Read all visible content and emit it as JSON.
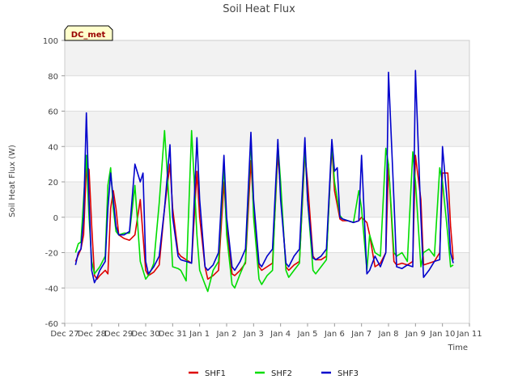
{
  "chart_data": {
    "type": "line",
    "title": "Soil Heat Flux",
    "xlabel": "Time",
    "ylabel": "Soil Heat Flux (W)",
    "ylim": [
      -60,
      100
    ],
    "yticks": [
      -60,
      -40,
      -20,
      0,
      20,
      40,
      60,
      80,
      100
    ],
    "xlim": [
      0,
      15
    ],
    "xtick_labels": [
      "Dec 27",
      "Dec 28",
      "Dec 29",
      "Dec 30",
      "Dec 31",
      "Jan 1",
      "Jan 2",
      "Jan 3",
      "Jan 4",
      "Jan 5",
      "Jan 6",
      "Jan 7",
      "Jan 8",
      "Jan 9",
      "Jan 10",
      "Jan 11"
    ],
    "grid": true,
    "legend": "bottom-center",
    "station_label": "DC_met",
    "series": [
      {
        "name": "SHF1",
        "color": "#dd0000",
        "x": [
          0.4,
          0.6,
          0.7,
          0.8,
          0.9,
          1.0,
          1.1,
          1.2,
          1.3,
          1.5,
          1.6,
          1.7,
          1.8,
          1.9,
          2.0,
          2.2,
          2.4,
          2.6,
          2.8,
          3.0,
          3.1,
          3.2,
          3.3,
          3.5,
          3.7,
          3.9,
          4.0,
          4.2,
          4.3,
          4.5,
          4.7,
          4.9,
          5.0,
          5.2,
          5.3,
          5.5,
          5.7,
          5.9,
          6.0,
          6.2,
          6.3,
          6.5,
          6.7,
          6.9,
          7.0,
          7.2,
          7.3,
          7.5,
          7.7,
          7.9,
          8.0,
          8.2,
          8.3,
          8.5,
          8.7,
          8.9,
          9.0,
          9.2,
          9.3,
          9.5,
          9.7,
          9.9,
          10.0,
          10.2,
          10.3,
          10.5,
          10.7,
          10.9,
          11.0,
          11.2,
          11.3,
          11.5,
          11.7,
          11.9,
          12.0,
          12.2,
          12.3,
          12.5,
          12.7,
          12.9,
          13.0,
          13.2,
          13.3,
          13.5,
          13.7,
          13.9,
          14.0,
          14.2,
          14.3,
          14.4
        ],
        "y": [
          -25,
          -18,
          -10,
          29,
          27,
          -5,
          -33,
          -35,
          -33,
          -30,
          -32,
          5,
          15,
          5,
          -10,
          -12,
          -13,
          -10,
          10,
          -30,
          -33,
          -32,
          -31,
          -27,
          5,
          30,
          5,
          -20,
          -22,
          -24,
          -26,
          26,
          0,
          -28,
          -35,
          -33,
          -30,
          20,
          -5,
          -32,
          -33,
          -30,
          -26,
          32,
          5,
          -28,
          -30,
          -28,
          -26,
          36,
          15,
          -28,
          -30,
          -27,
          -25,
          36,
          20,
          -22,
          -24,
          -24,
          -22,
          40,
          15,
          -1,
          -2,
          -2,
          -3,
          -2,
          0,
          -3,
          -10,
          -28,
          -26,
          -20,
          30,
          -25,
          -27,
          -26,
          -27,
          -25,
          35,
          10,
          -27,
          -26,
          -25,
          -20,
          25,
          25,
          -5,
          -24
        ]
      },
      {
        "name": "SHF2",
        "color": "#00dd00",
        "x": [
          0.4,
          0.5,
          0.6,
          0.7,
          0.8,
          0.9,
          1.0,
          1.1,
          1.2,
          1.3,
          1.5,
          1.6,
          1.7,
          1.8,
          1.9,
          2.0,
          2.2,
          2.4,
          2.6,
          2.8,
          3.0,
          3.1,
          3.2,
          3.3,
          3.5,
          3.7,
          3.9,
          4.0,
          4.2,
          4.3,
          4.5,
          4.7,
          4.8,
          4.9,
          5.0,
          5.2,
          5.3,
          5.5,
          5.7,
          5.9,
          6.0,
          6.2,
          6.3,
          6.5,
          6.7,
          6.9,
          7.0,
          7.2,
          7.3,
          7.5,
          7.7,
          7.9,
          8.0,
          8.2,
          8.3,
          8.5,
          8.7,
          8.9,
          9.0,
          9.2,
          9.3,
          9.5,
          9.7,
          9.9,
          10.0,
          10.2,
          10.3,
          10.5,
          10.7,
          10.9,
          11.0,
          11.2,
          11.3,
          11.5,
          11.7,
          11.9,
          12.0,
          12.2,
          12.3,
          12.5,
          12.7,
          12.9,
          13.0,
          13.2,
          13.3,
          13.5,
          13.7,
          13.9,
          14.0,
          14.2,
          14.3,
          14.4
        ],
        "y": [
          -20,
          -15,
          -14,
          10,
          35,
          0,
          -25,
          -32,
          -30,
          -28,
          -22,
          18,
          28,
          5,
          -8,
          -10,
          -9,
          -9,
          18,
          -25,
          -35,
          -33,
          -30,
          -26,
          8,
          49,
          0,
          -28,
          -29,
          -30,
          -36,
          49,
          20,
          -10,
          -30,
          -38,
          -42,
          -30,
          -25,
          30,
          -10,
          -38,
          -40,
          -32,
          -25,
          45,
          0,
          -35,
          -38,
          -33,
          -30,
          42,
          20,
          -30,
          -34,
          -30,
          -26,
          40,
          10,
          -30,
          -32,
          -28,
          -24,
          42,
          20,
          1,
          -1,
          -2,
          -3,
          15,
          5,
          -30,
          -10,
          -20,
          -22,
          39,
          30,
          -20,
          -22,
          -20,
          -25,
          37,
          20,
          -28,
          -20,
          -18,
          -22,
          28,
          20,
          -10,
          -28,
          -27
        ]
      },
      {
        "name": "SHF3",
        "color": "#0000cc",
        "x": [
          0.4,
          0.5,
          0.6,
          0.7,
          0.8,
          0.9,
          1.0,
          1.1,
          1.2,
          1.3,
          1.5,
          1.6,
          1.7,
          1.8,
          1.9,
          2.0,
          2.2,
          2.4,
          2.6,
          2.8,
          2.9,
          3.0,
          3.1,
          3.2,
          3.3,
          3.5,
          3.7,
          3.9,
          4.0,
          4.2,
          4.3,
          4.5,
          4.7,
          4.9,
          5.0,
          5.2,
          5.3,
          5.5,
          5.7,
          5.9,
          6.0,
          6.2,
          6.3,
          6.5,
          6.7,
          6.9,
          7.0,
          7.2,
          7.3,
          7.5,
          7.7,
          7.9,
          8.0,
          8.2,
          8.3,
          8.5,
          8.7,
          8.9,
          9.0,
          9.2,
          9.3,
          9.5,
          9.7,
          9.9,
          10.0,
          10.1,
          10.2,
          10.3,
          10.5,
          10.7,
          10.9,
          11.0,
          11.2,
          11.3,
          11.5,
          11.7,
          11.9,
          12.0,
          12.2,
          12.3,
          12.5,
          12.7,
          12.9,
          13.0,
          13.2,
          13.3,
          13.5,
          13.7,
          13.9,
          14.0,
          14.2,
          14.3,
          14.4
        ],
        "y": [
          -27,
          -20,
          -18,
          0,
          59,
          10,
          -30,
          -37,
          -34,
          -30,
          -25,
          5,
          25,
          10,
          -5,
          -10,
          -10,
          -8,
          30,
          20,
          25,
          -25,
          -32,
          -30,
          -28,
          -22,
          5,
          41,
          0,
          -22,
          -24,
          -25,
          -26,
          45,
          10,
          -28,
          -30,
          -27,
          -20,
          35,
          0,
          -28,
          -30,
          -25,
          -18,
          48,
          10,
          -26,
          -28,
          -22,
          -18,
          44,
          10,
          -26,
          -28,
          -22,
          -18,
          45,
          10,
          -23,
          -24,
          -22,
          -18,
          44,
          26,
          28,
          0,
          -1,
          -2,
          -3,
          -2,
          35,
          -32,
          -30,
          -22,
          -28,
          -20,
          82,
          10,
          -28,
          -29,
          -27,
          -28,
          83,
          0,
          -34,
          -30,
          -25,
          -24,
          40,
          5,
          -20,
          -26
        ]
      }
    ]
  }
}
